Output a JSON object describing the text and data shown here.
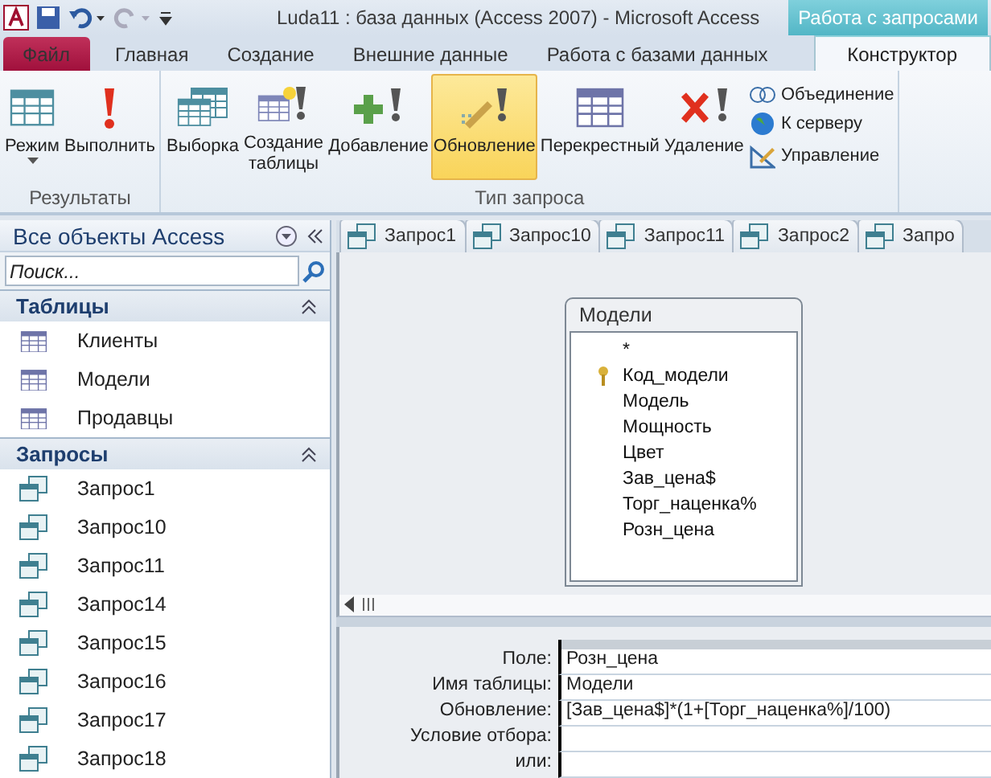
{
  "window": {
    "title": "Luda11 : база данных (Access 2007)  -  Microsoft Access",
    "context_tab": "Работа с запросами"
  },
  "ribbon_tabs": [
    {
      "label": "Файл",
      "kind": "file",
      "selected": false
    },
    {
      "label": "Главная",
      "kind": "normal",
      "selected": false
    },
    {
      "label": "Создание",
      "kind": "normal",
      "selected": false
    },
    {
      "label": "Внешние данные",
      "kind": "normal",
      "selected": false
    },
    {
      "label": "Работа с базами данных",
      "kind": "normal",
      "selected": false
    },
    {
      "label": "Конструктор",
      "kind": "normal",
      "selected": true
    }
  ],
  "ribbon_groups": [
    {
      "label": "Результаты",
      "buttons": [
        {
          "label": "Режим",
          "selected": false,
          "dropdown": true
        },
        {
          "label": "Выполнить",
          "selected": false,
          "dropdown": false
        }
      ]
    },
    {
      "label": "Тип запроса",
      "buttons": [
        {
          "label": "Выборка",
          "selected": false,
          "dropdown": false
        },
        {
          "label": "Создание таблицы",
          "selected": false,
          "dropdown": false
        },
        {
          "label": "Добавление",
          "selected": false,
          "dropdown": false
        },
        {
          "label": "Обновление",
          "selected": true,
          "dropdown": false
        },
        {
          "label": "Перекрестный",
          "selected": false,
          "dropdown": false
        },
        {
          "label": "Удаление",
          "selected": false,
          "dropdown": false
        }
      ],
      "small_buttons": [
        "Объединение",
        "К серверу",
        "Управление"
      ]
    }
  ],
  "nav_pane": {
    "title": "Все объекты Access",
    "search": {
      "placeholder": "Поиск..."
    },
    "sections": [
      {
        "title": "Таблицы",
        "kind": "table",
        "expanded": true,
        "items": [
          "Клиенты",
          "Модели",
          "Продавцы"
        ]
      },
      {
        "title": "Запросы",
        "kind": "query",
        "expanded": true,
        "items": [
          "Запрос1",
          "Запрос10",
          "Запрос11",
          "Запрос14",
          "Запрос15",
          "Запрос16",
          "Запрос17",
          "Запрос18"
        ]
      }
    ]
  },
  "object_tabs": [
    "Запрос1",
    "Запрос10",
    "Запрос11",
    "Запрос2",
    "Запро"
  ],
  "field_list": {
    "title": "Модели",
    "fields": [
      {
        "name": "*",
        "key": false
      },
      {
        "name": "Код_модели",
        "key": true
      },
      {
        "name": "Модель",
        "key": false
      },
      {
        "name": "Мощность",
        "key": false
      },
      {
        "name": "Цвет",
        "key": false
      },
      {
        "name": "Зав_цена$",
        "key": false
      },
      {
        "name": "Торг_наценка%",
        "key": false
      },
      {
        "name": "Розн_цена",
        "key": false
      }
    ]
  },
  "design_grid": [
    {
      "label": "Поле:",
      "value": "Розн_цена"
    },
    {
      "label": "Имя таблицы:",
      "value": "Модели"
    },
    {
      "label": "Обновление:",
      "value": "[Зав_цена$]*(1+[Торг_наценка%]/100)"
    },
    {
      "label": "Условие отбора:"
    },
    {
      "label": "или:"
    }
  ]
}
